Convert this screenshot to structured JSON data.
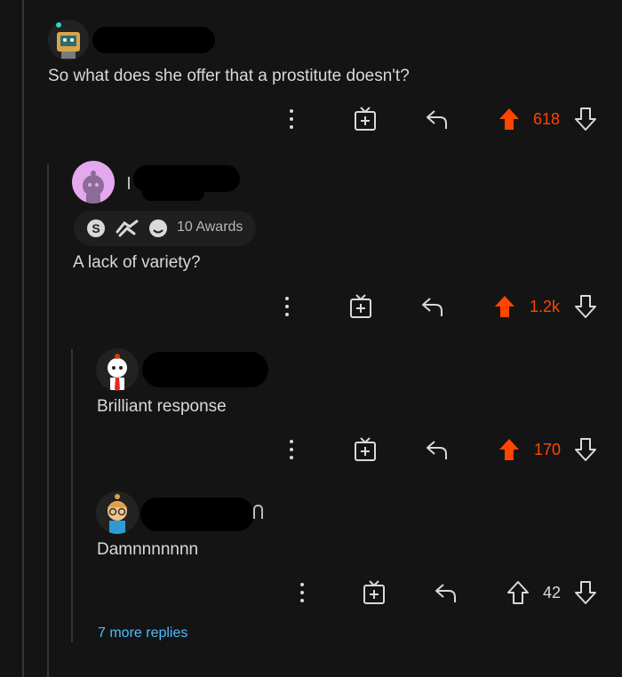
{
  "comments": [
    {
      "username": "",
      "body": "So what does she offer that a prostitute doesn't?",
      "score": "618",
      "vote": "up"
    },
    {
      "username": "",
      "awards": {
        "label": "10 Awards"
      },
      "body": "A lack of variety?",
      "score": "1.2k",
      "vote": "up"
    },
    {
      "username": "",
      "body": "Brilliant response",
      "score": "170",
      "vote": "up"
    },
    {
      "username": "",
      "body": "Damnnnnnnn",
      "score": "42",
      "vote": "none"
    }
  ],
  "more_replies": "7 more replies",
  "colors": {
    "background": "#141414",
    "upvote": "#ff4500",
    "link": "#4fbcff",
    "text": "#d7dadc"
  }
}
